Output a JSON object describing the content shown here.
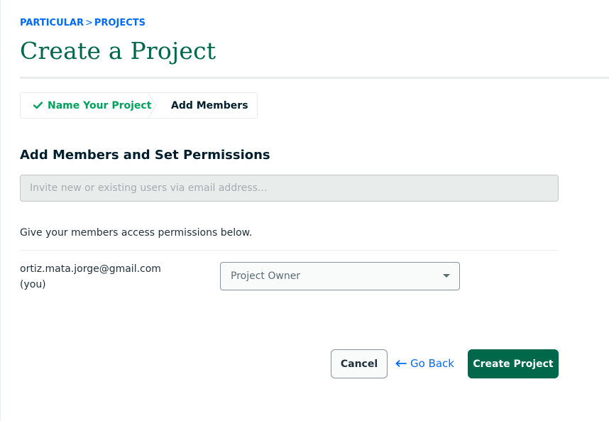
{
  "breadcrumb": {
    "org": "PARTICULAR",
    "separator": ">",
    "section": "PROJECTS"
  },
  "page_title": "Create a Project",
  "wizard": {
    "steps": [
      {
        "label": "Name Your Project",
        "status": "complete",
        "icon": "check-icon"
      },
      {
        "label": "Add Members",
        "status": "current"
      }
    ]
  },
  "members_section": {
    "heading": "Add Members and Set Permissions",
    "invite_placeholder": "Invite new or existing users via email address...",
    "invite_value": "",
    "permissions_text": "Give your members access permissions below.",
    "members": [
      {
        "email": "ortiz.mata.jorge@gmail.com (you)",
        "role": "Project Owner"
      }
    ]
  },
  "footer": {
    "cancel_label": "Cancel",
    "go_back_label": "Go Back",
    "create_label": "Create Project"
  },
  "colors": {
    "brand_green": "#00684a",
    "link_blue": "#016bf8",
    "success_green": "#00a35c"
  }
}
